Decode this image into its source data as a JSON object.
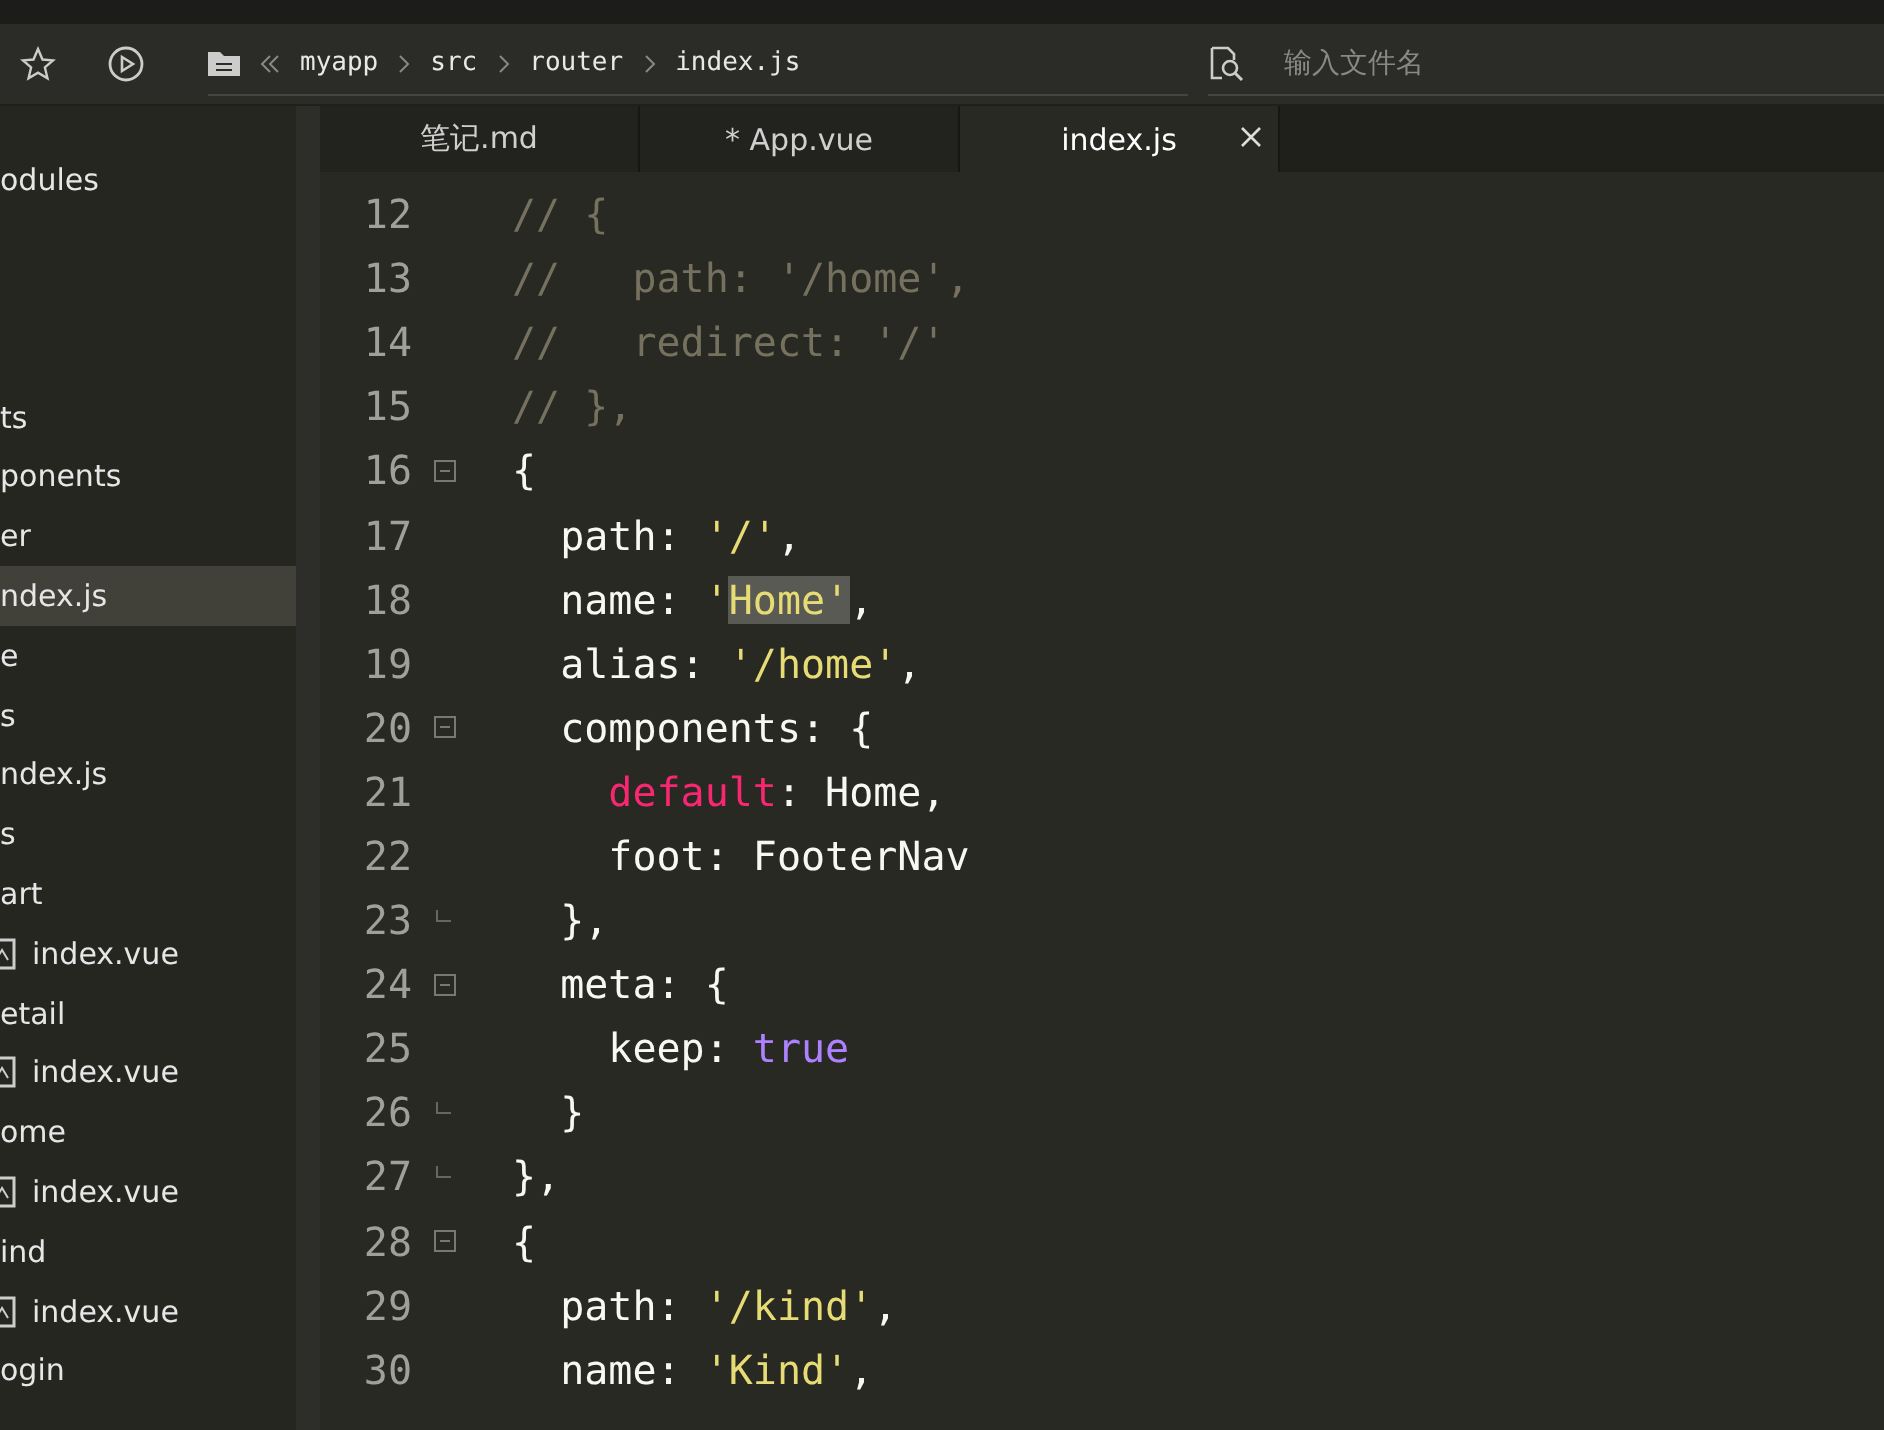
{
  "toolbar": {
    "breadcrumb": [
      "myapp",
      "src",
      "router",
      "index.js"
    ],
    "search": {
      "placeholder": "输入文件名"
    }
  },
  "sidebar": {
    "root_item": {
      "label": "odules",
      "kind": "folder",
      "selected": false
    },
    "items": [
      {
        "label": "ts",
        "kind": "folder",
        "selected": false
      },
      {
        "label": "ponents",
        "kind": "folder",
        "selected": false
      },
      {
        "label": "er",
        "kind": "folder",
        "selected": false
      },
      {
        "label": "ndex.js",
        "kind": "folder",
        "selected": true
      },
      {
        "label": "e",
        "kind": "folder",
        "selected": false
      },
      {
        "label": "s",
        "kind": "folder",
        "selected": false
      },
      {
        "label": "ndex.js",
        "kind": "folder",
        "selected": false
      },
      {
        "label": "s",
        "kind": "folder",
        "selected": false
      },
      {
        "label": "art",
        "kind": "folder",
        "selected": false
      },
      {
        "label": "index.vue",
        "kind": "file",
        "selected": false
      },
      {
        "label": "etail",
        "kind": "folder",
        "selected": false
      },
      {
        "label": "index.vue",
        "kind": "file",
        "selected": false
      },
      {
        "label": "ome",
        "kind": "folder",
        "selected": false
      },
      {
        "label": "index.vue",
        "kind": "file",
        "selected": false
      },
      {
        "label": "ind",
        "kind": "folder",
        "selected": false
      },
      {
        "label": "index.vue",
        "kind": "file",
        "selected": false
      },
      {
        "label": "ogin",
        "kind": "folder",
        "selected": false
      }
    ]
  },
  "tabs": [
    {
      "label": "笔记.md",
      "selected": false,
      "closable": false
    },
    {
      "label": "* App.vue",
      "selected": false,
      "closable": false
    },
    {
      "label": "index.js",
      "selected": true,
      "closable": true
    }
  ],
  "editor": {
    "lines": [
      {
        "number": "12",
        "fold_start": false,
        "fold_end": false,
        "tokens": [
          {
            "kind": "comment",
            "text": "// {"
          }
        ]
      },
      {
        "number": "13",
        "fold_start": false,
        "fold_end": false,
        "tokens": [
          {
            "kind": "comment",
            "text": "//   path: '/home',"
          }
        ]
      },
      {
        "number": "14",
        "fold_start": false,
        "fold_end": false,
        "tokens": [
          {
            "kind": "comment",
            "text": "//   redirect: '/'"
          }
        ]
      },
      {
        "number": "15",
        "fold_start": false,
        "fold_end": false,
        "tokens": [
          {
            "kind": "comment",
            "text": "// },"
          }
        ]
      },
      {
        "number": "16",
        "fold_start": true,
        "fold_end": false,
        "tokens": [
          {
            "kind": "plain",
            "text": "{"
          }
        ]
      },
      {
        "number": "17",
        "fold_start": false,
        "fold_end": false,
        "tokens": [
          {
            "kind": "plain",
            "text": "  path: "
          },
          {
            "kind": "string",
            "text": "'/'"
          },
          {
            "kind": "plain",
            "text": ","
          }
        ]
      },
      {
        "number": "18",
        "fold_start": false,
        "fold_end": false,
        "tokens": [
          {
            "kind": "plain",
            "text": "  name: "
          },
          {
            "kind": "string",
            "text": "'"
          },
          {
            "kind": "string",
            "text": "Home'",
            "highlighted": true
          },
          {
            "kind": "plain",
            "text": ","
          }
        ]
      },
      {
        "number": "19",
        "fold_start": false,
        "fold_end": false,
        "tokens": [
          {
            "kind": "plain",
            "text": "  alias: "
          },
          {
            "kind": "string",
            "text": "'/home'"
          },
          {
            "kind": "plain",
            "text": ","
          }
        ]
      },
      {
        "number": "20",
        "fold_start": true,
        "fold_end": false,
        "tokens": [
          {
            "kind": "plain",
            "text": "  components: {"
          }
        ]
      },
      {
        "number": "21",
        "fold_start": false,
        "fold_end": false,
        "tokens": [
          {
            "kind": "keyword",
            "text": "    default"
          },
          {
            "kind": "plain",
            "text": ": Home,"
          }
        ]
      },
      {
        "number": "22",
        "fold_start": false,
        "fold_end": false,
        "tokens": [
          {
            "kind": "plain",
            "text": "    foot: FooterNav"
          }
        ]
      },
      {
        "number": "23",
        "fold_start": false,
        "fold_end": true,
        "tokens": [
          {
            "kind": "plain",
            "text": "  },"
          }
        ]
      },
      {
        "number": "24",
        "fold_start": true,
        "fold_end": false,
        "tokens": [
          {
            "kind": "plain",
            "text": "  meta: {"
          }
        ]
      },
      {
        "number": "25",
        "fold_start": false,
        "fold_end": false,
        "tokens": [
          {
            "kind": "plain",
            "text": "    keep: "
          },
          {
            "kind": "constant",
            "text": "true"
          }
        ]
      },
      {
        "number": "26",
        "fold_start": false,
        "fold_end": true,
        "tokens": [
          {
            "kind": "plain",
            "text": "  }"
          }
        ]
      },
      {
        "number": "27",
        "fold_start": false,
        "fold_end": true,
        "tokens": [
          {
            "kind": "plain",
            "text": "},"
          }
        ]
      },
      {
        "number": "28",
        "fold_start": true,
        "fold_end": false,
        "tokens": [
          {
            "kind": "plain",
            "text": "{"
          }
        ]
      },
      {
        "number": "29",
        "fold_start": false,
        "fold_end": false,
        "tokens": [
          {
            "kind": "plain",
            "text": "  path: "
          },
          {
            "kind": "string",
            "text": "'/kind'"
          },
          {
            "kind": "plain",
            "text": ","
          }
        ]
      },
      {
        "number": "30",
        "fold_start": false,
        "fold_end": false,
        "tokens": [
          {
            "kind": "plain",
            "text": "  name: "
          },
          {
            "kind": "string",
            "text": "'Kind'"
          },
          {
            "kind": "plain",
            "text": ","
          }
        ]
      }
    ]
  }
}
